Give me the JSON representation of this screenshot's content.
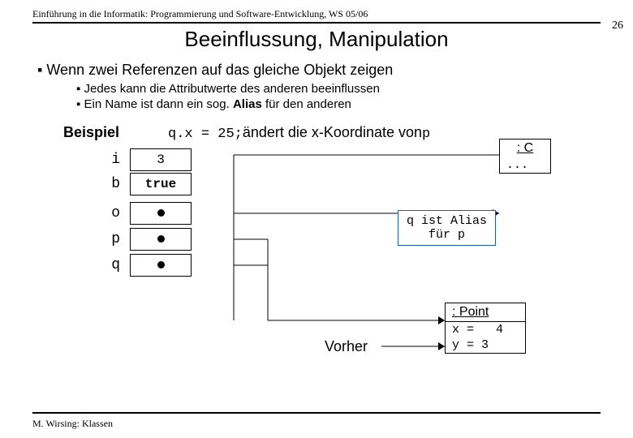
{
  "header": {
    "course": "Einführung in die Informatik: Programmierung und Software-Entwicklung, WS 05/06",
    "page_number": "26"
  },
  "title": "Beeinflussung, Manipulation",
  "bullets": {
    "l1": "Wenn zwei Referenzen auf das gleiche Objekt zeigen",
    "l2a": "Jedes kann die Attributwerte des anderen beeinflussen",
    "l2b_pre": "Ein Name ist dann ein sog. ",
    "l2b_bold": "Alias",
    "l2b_post": " für den anderen"
  },
  "example": {
    "label": "Beispiel",
    "code": "q.x = 25;",
    "sentence_pre": " ändert die x-Koordinate von ",
    "sentence_var": "p"
  },
  "vars": {
    "i": {
      "name": "i",
      "value": "3"
    },
    "b": {
      "name": "b",
      "value": "true"
    },
    "o": {
      "name": "o"
    },
    "p": {
      "name": "p"
    },
    "q": {
      "name": "q"
    }
  },
  "objC": {
    "head": ": C",
    "body": "..."
  },
  "callout": {
    "line1": "q ist Alias",
    "line2": "für p"
  },
  "objPoint": {
    "head": ": Point",
    "row1": "x =   4",
    "row2": "y = 3"
  },
  "vorher": "Vorher",
  "footer": "M. Wirsing: Klassen"
}
